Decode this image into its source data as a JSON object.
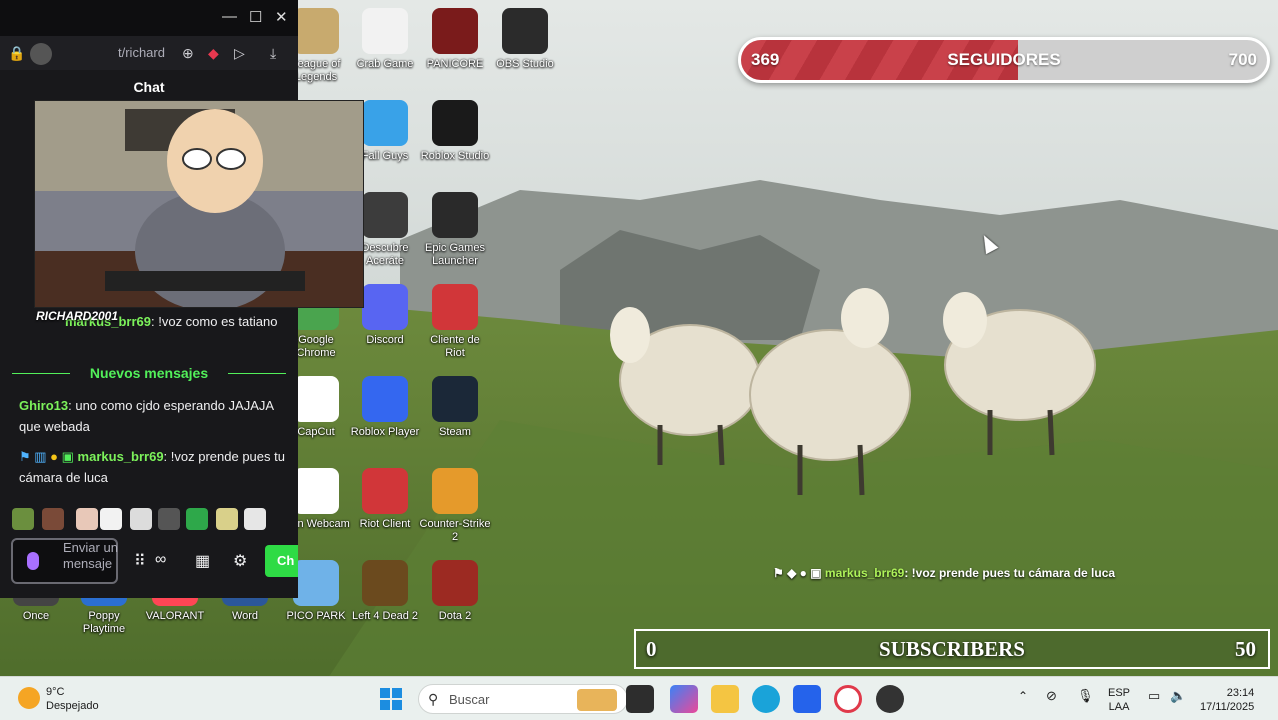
{
  "desktop": {
    "icons": [
      {
        "label": "League of Legends",
        "color": "#c8aa6e"
      },
      {
        "label": "Crab Game",
        "color": "#f2f2f2"
      },
      {
        "label": "PANICORE",
        "color": "#7a1b1b"
      },
      {
        "label": "OBS Studio",
        "color": "#2b2b2b"
      },
      {
        "label": "Fall Guys",
        "color": "#39a2e8"
      },
      {
        "label": "Roblox Studio",
        "color": "#1a1a1a"
      },
      {
        "label": "Descubre Aceráte",
        "color": "#3c3c3c"
      },
      {
        "label": "Epic Games Launcher",
        "color": "#2a2a2a"
      },
      {
        "label": "Google Chrome",
        "color": "#4aa44e"
      },
      {
        "label": "Discord",
        "color": "#5865f2"
      },
      {
        "label": "Cliente de Riot",
        "color": "#d13639"
      },
      {
        "label": "CapCut",
        "color": "#ffffff"
      },
      {
        "label": "Roblox Player",
        "color": "#3467f0"
      },
      {
        "label": "Steam",
        "color": "#1b2838"
      },
      {
        "label": "Inun Webcam",
        "color": "#ffffff"
      },
      {
        "label": "Riot Client",
        "color": "#d13639"
      },
      {
        "label": "Counter-Strike 2",
        "color": "#e59a2b"
      },
      {
        "label": "PICO PARK",
        "color": "#6fb2e8"
      },
      {
        "label": "Left 4 Dead 2",
        "color": "#6b4a1e"
      },
      {
        "label": "Dota 2",
        "color": "#9c2a22"
      },
      {
        "label": "Once",
        "color": "#444"
      },
      {
        "label": "Poppy Playtime",
        "color": "#2b6fd1"
      },
      {
        "label": "VALORANT",
        "color": "#ff4655"
      },
      {
        "label": "Word",
        "color": "#2b579a"
      }
    ]
  },
  "overlay": {
    "followers": {
      "current": "369",
      "label": "SEGUIDORES",
      "goal": "700",
      "progress": 0.527
    },
    "subscribers": {
      "current": "0",
      "label": "SUBSCRIBERS",
      "goal": "50"
    },
    "chat_user": "markus_brr69",
    "chat_text": ": !voz prende pues tu cámara de luca"
  },
  "chat_window": {
    "url": "t/richard",
    "heading": "Chat",
    "cam_name": "RICHARD2001",
    "messages": [
      {
        "user": "markus_brr69",
        "text": ": !voz como es tatiano"
      },
      {
        "user": "Ghiro13",
        "text": ": uno como cjdo esperando JAJAJA que webada"
      },
      {
        "user": "markus_brr69",
        "text": ": !voz prende pues tu cámara de luca"
      }
    ],
    "new_messages": "Nuevos mensajes",
    "input_placeholder": "Enviar un mensaje",
    "send_label": "Ch"
  },
  "taskbar": {
    "temperature": "9°C",
    "weather": "Despejado",
    "search_placeholder": "Buscar",
    "lang_top": "ESP",
    "lang_bottom": "LAA",
    "time": "23:14",
    "date": "17/11/2025"
  }
}
